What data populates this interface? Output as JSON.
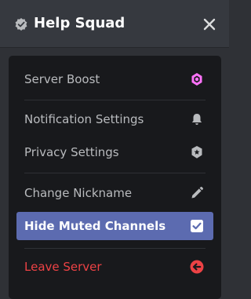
{
  "header": {
    "server_name": "Help Squad",
    "verified_icon": "verified-check-icon",
    "close_icon": "close-icon"
  },
  "menu": {
    "items": [
      {
        "label": "Server Boost",
        "icon": "boost-gem-icon",
        "icon_color": "#ff73fa"
      },
      {
        "label": "Notification Settings",
        "icon": "bell-icon",
        "icon_color": "#b9bbbe"
      },
      {
        "label": "Privacy Settings",
        "icon": "shield-star-icon",
        "icon_color": "#b9bbbe"
      },
      {
        "label": "Change Nickname",
        "icon": "pencil-icon",
        "icon_color": "#b9bbbe"
      },
      {
        "label": "Hide Muted Channels",
        "icon": "checkbox-checked-icon",
        "icon_color": "#ffffff",
        "selected": true
      },
      {
        "label": "Leave Server",
        "icon": "leave-arrow-icon",
        "icon_color": "#ed4245"
      }
    ]
  },
  "colors": {
    "selected_bg": "#5c6bb0",
    "danger": "#ed4245",
    "menu_bg": "#18191c",
    "header_bg": "#36393f"
  }
}
